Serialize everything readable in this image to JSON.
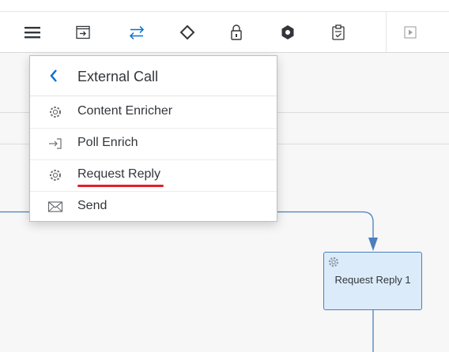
{
  "toolbar": {
    "buttons": [
      {
        "name": "menu-icon"
      },
      {
        "name": "participant-icon"
      },
      {
        "name": "call-icon"
      },
      {
        "name": "router-icon"
      },
      {
        "name": "security-lock-icon"
      },
      {
        "name": "persistence-icon"
      },
      {
        "name": "validator-icon"
      },
      {
        "name": "play-icon"
      }
    ]
  },
  "popover": {
    "title": "External Call",
    "back_icon": "chevron-left-icon",
    "items": [
      {
        "label": "Content Enricher",
        "icon": "gear-icon"
      },
      {
        "label": "Poll Enrich",
        "icon": "poll-arrow-icon"
      },
      {
        "label": "Request Reply",
        "icon": "gear-icon",
        "highlighted": true
      },
      {
        "label": "Send",
        "icon": "envelope-icon"
      }
    ]
  },
  "flow_step": {
    "label": "Request Reply 1",
    "icon": "gear-icon"
  },
  "colors": {
    "accent": "#0a6ed1",
    "flow_line": "#4a7fbd",
    "step_fill": "#dcebfa",
    "highlight_underline": "#e0202a"
  }
}
